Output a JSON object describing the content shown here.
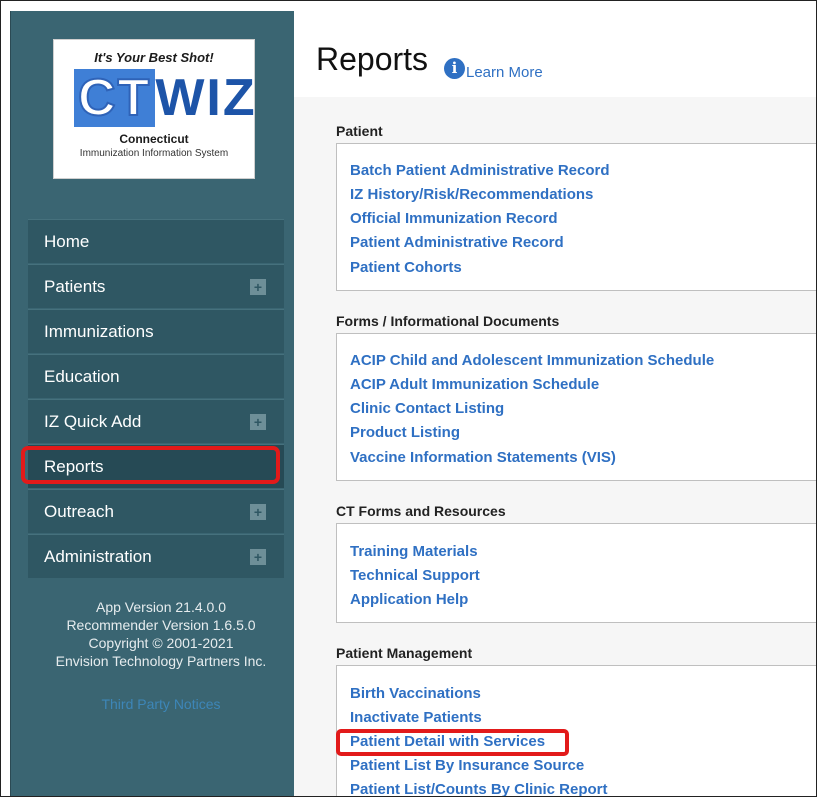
{
  "logo": {
    "tagline": "It's Your Best Shot!",
    "ct": "CT",
    "wiz": "WIZ",
    "state": "Connecticut",
    "system": "Immunization Information System"
  },
  "nav": [
    {
      "label": "Home",
      "expand": false
    },
    {
      "label": "Patients",
      "expand": true
    },
    {
      "label": "Immunizations",
      "expand": false
    },
    {
      "label": "Education",
      "expand": false
    },
    {
      "label": "IZ Quick Add",
      "expand": true
    },
    {
      "label": "Reports",
      "expand": false
    },
    {
      "label": "Outreach",
      "expand": true
    },
    {
      "label": "Administration",
      "expand": true
    }
  ],
  "meta": {
    "app_version": "App Version 21.4.0.0",
    "recommender": "Recommender Version 1.6.5.0",
    "copyright": "Copyright © 2001-2021",
    "company": "Envision Technology Partners Inc.",
    "third_party": "Third Party Notices"
  },
  "page": {
    "title": "Reports",
    "learn_more": "Learn More",
    "info_icon": "i"
  },
  "sections": [
    {
      "title": "Patient",
      "links": [
        "Batch Patient Administrative Record",
        "IZ History/Risk/Recommendations",
        "Official Immunization Record",
        "Patient Administrative Record",
        "Patient Cohorts"
      ]
    },
    {
      "title": "Forms / Informational Documents",
      "links": [
        "ACIP Child and Adolescent Immunization Schedule",
        "ACIP Adult Immunization Schedule",
        "Clinic Contact Listing",
        "Product Listing",
        "Vaccine Information Statements (VIS)"
      ]
    },
    {
      "title": "CT Forms and Resources",
      "links": [
        "Training Materials",
        "Technical Support",
        "Application Help"
      ]
    },
    {
      "title": "Patient Management",
      "links": [
        "Birth Vaccinations",
        "Inactivate Patients",
        "Patient Detail with Services",
        "Patient List By Insurance Source",
        "Patient List/Counts By Clinic Report"
      ]
    }
  ],
  "icons": {
    "expand": "plus-icon",
    "info": "info-icon"
  }
}
